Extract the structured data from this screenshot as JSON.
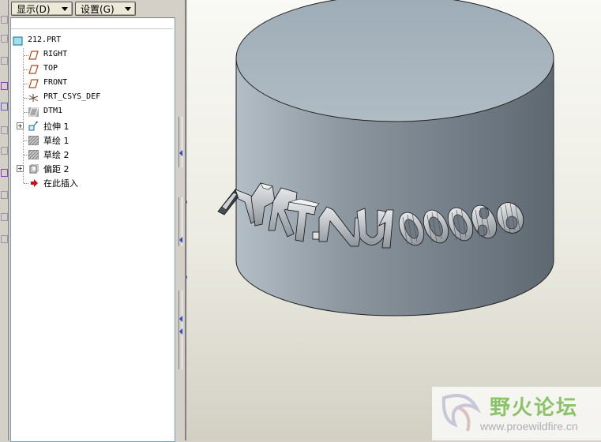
{
  "toolbar": {
    "display_label": "显示(D)",
    "settings_label": "设置(G)"
  },
  "tree": {
    "items": [
      {
        "label": "212.PRT",
        "icon": "part-icon"
      },
      {
        "label": "RIGHT",
        "icon": "datum-plane-icon"
      },
      {
        "label": "TOP",
        "icon": "datum-plane-icon"
      },
      {
        "label": "FRONT",
        "icon": "datum-plane-icon"
      },
      {
        "label": "PRT_CSYS_DEF",
        "icon": "coordinate-system-icon"
      },
      {
        "label": "DTM1",
        "icon": "datum-plane-hidden-icon"
      },
      {
        "label": "拉伸 1",
        "icon": "extrude-icon"
      },
      {
        "label": "草绘 1",
        "icon": "sketch-icon"
      },
      {
        "label": "草绘 2",
        "icon": "sketch-icon"
      },
      {
        "label": "偏距 2",
        "icon": "offset-icon"
      },
      {
        "label": "在此插入",
        "icon": "insert-here-arrow-icon"
      }
    ]
  },
  "model": {
    "embossed_text": "APRT.NU100086",
    "top_color": "#a9b6bf",
    "side_color": "#7a8690"
  },
  "watermark": {
    "title": "野火论坛",
    "url": "www.proewildfire.cn"
  }
}
